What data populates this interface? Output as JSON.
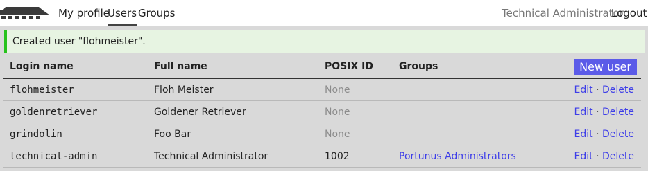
{
  "nav": {
    "links": [
      "My profile",
      "Users",
      "Groups"
    ],
    "active": "Users",
    "current_user": "Technical Administrator",
    "logout": "Logout"
  },
  "flash": "Created user \"flohmeister\".",
  "table": {
    "headers": [
      "Login name",
      "Full name",
      "POSIX ID",
      "Groups"
    ],
    "new_user_label": "New user",
    "edit_label": "Edit",
    "delete_label": "Delete",
    "separator": "·",
    "rows": [
      {
        "login": "flohmeister",
        "full_name": "Floh Meister",
        "posix_id": "None",
        "groups": ""
      },
      {
        "login": "goldenretriever",
        "full_name": "Goldener Retriever",
        "posix_id": "None",
        "groups": ""
      },
      {
        "login": "grindolin",
        "full_name": "Foo Bar",
        "posix_id": "None",
        "groups": ""
      },
      {
        "login": "technical-admin",
        "full_name": "Technical Administrator",
        "posix_id": "1002",
        "groups": "Portunus Administrators"
      }
    ]
  },
  "colors": {
    "accent": "#5b5be8",
    "link": "#3e3ee8",
    "flash_border": "#27c21c",
    "flash_background": "#e7f4e2"
  }
}
